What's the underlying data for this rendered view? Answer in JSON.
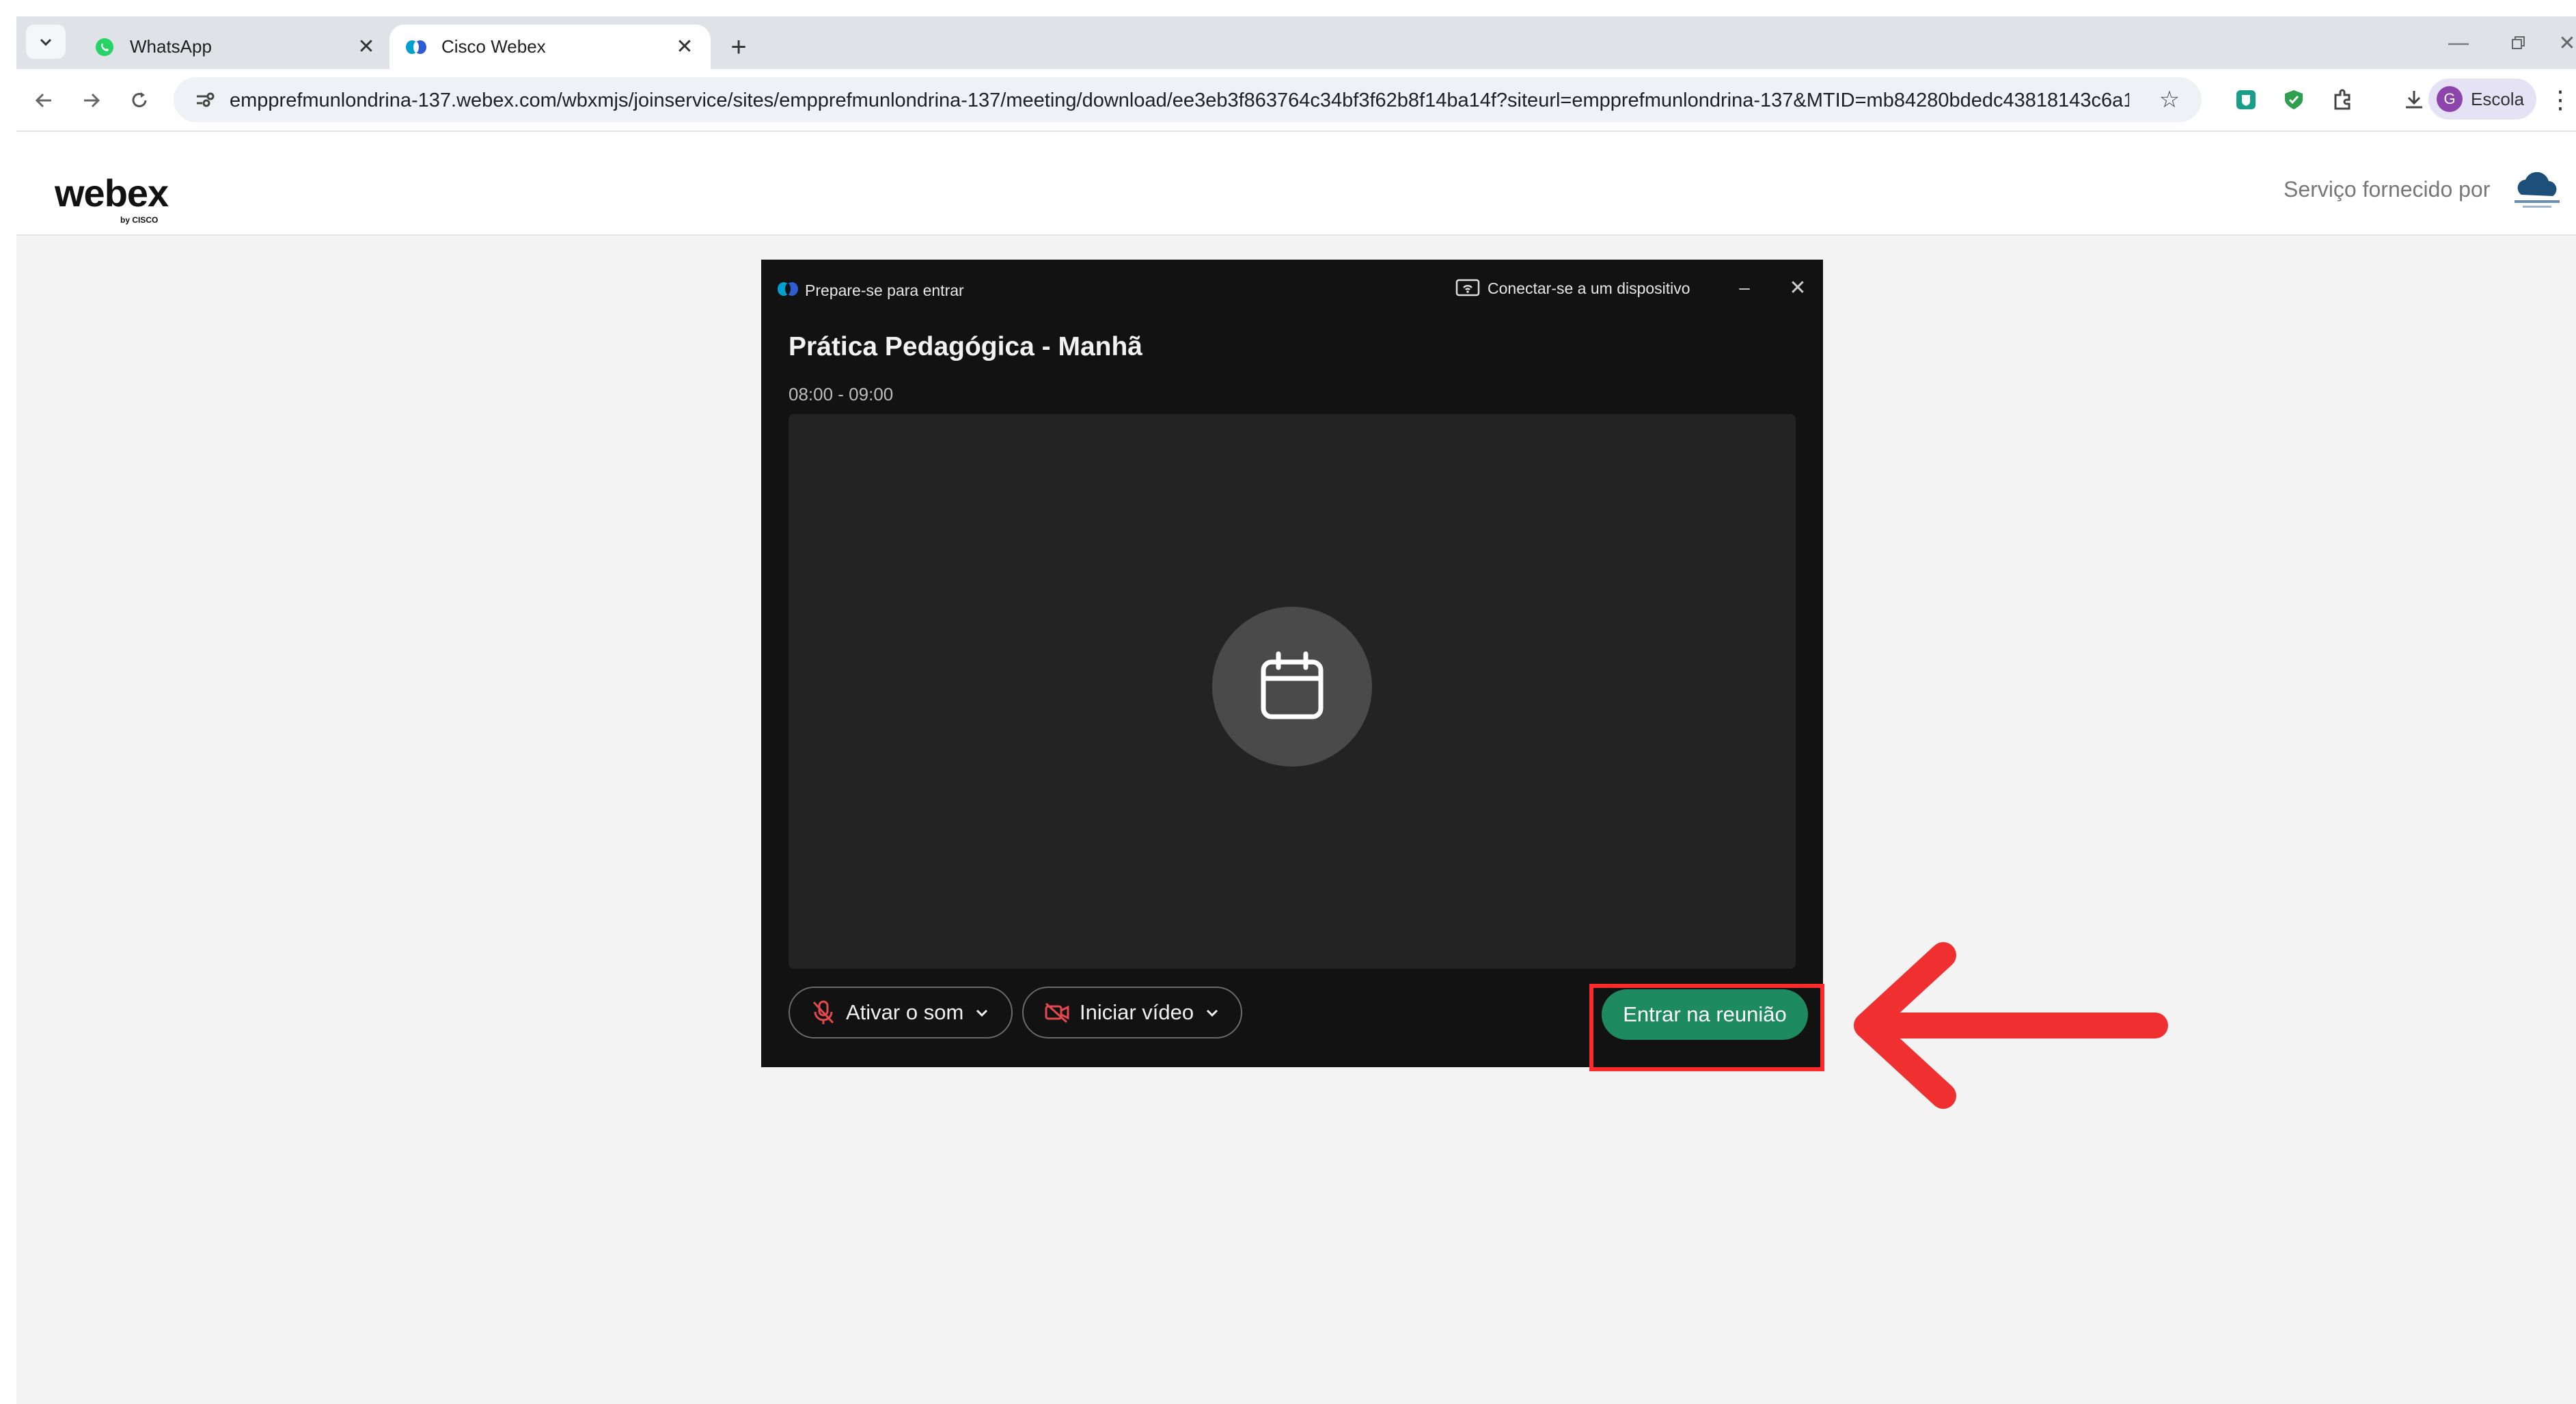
{
  "browser": {
    "tabs": [
      {
        "title": "WhatsApp",
        "icon": "whatsapp-icon",
        "active": false
      },
      {
        "title": "Cisco Webex",
        "icon": "webex-icon",
        "active": true
      }
    ],
    "url": "empprefmunlondrina-137.webex.com/wbxmjs/joinservice/sites/empprefmunlondrina-137/meeting/download/ee3eb3f863764c34bf3f62b8f14ba14f?siteurl=empprefmunlondrina-137&MTID=mb84280bdedc43818143c6a11f628d...",
    "profile": {
      "initial": "G",
      "name": "Escola"
    }
  },
  "page": {
    "brand": "webex",
    "brand_sub": "by CISCO",
    "provided_by": "Serviço fornecido por"
  },
  "dialog": {
    "title": "Prepare-se para entrar",
    "connect_device": "Conectar-se a um dispositivo",
    "meeting_name": "Prática Pedagógica - Manhã",
    "meeting_time": "08:00 - 09:00",
    "audio_button": "Ativar o som",
    "video_button": "Iniciar vídeo",
    "join_button": "Entrar na reunião"
  },
  "colors": {
    "dialog_bg": "#121212",
    "join_button": "#1e8a5f",
    "annotation": "#ff2a2a",
    "muted_icon": "#e5484d"
  }
}
